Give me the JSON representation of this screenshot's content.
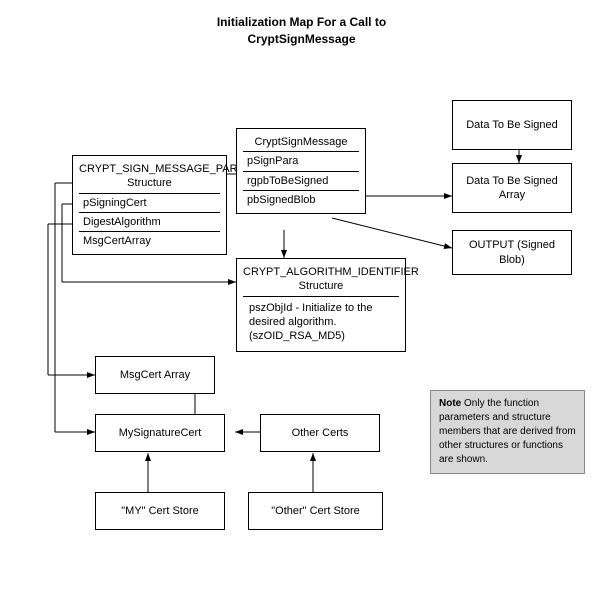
{
  "title": {
    "line1": "Initialization Map For a Call to",
    "line2": "CryptSignMessage"
  },
  "boxes": {
    "crypt_sign_message_para": {
      "header": "CRYPT_SIGN_MESSAGE_PARA Structure",
      "rows": [
        "pSigningCert",
        "DigestAlgorithm",
        "MsgCertArray"
      ]
    },
    "crypt_sign_message": {
      "header": "CryptSignMessage",
      "rows": [
        "pSignPara",
        "rgpbToBeSigned",
        "pbSignedBlob"
      ]
    },
    "crypt_algorithm": {
      "header": "CRYPT_ALGORITHM_IDENTIFIER Structure",
      "body": "pszObjId - Initialize to the desired algorithm. (szOID_RSA_MD5)"
    },
    "data_to_be_signed": {
      "label": "Data To Be Signed"
    },
    "data_to_be_signed_array": {
      "label": "Data To Be Signed Array"
    },
    "output": {
      "label": "OUTPUT (Signed Blob)"
    },
    "msgcert_array": {
      "label": "MsgCert Array"
    },
    "my_signature_cert": {
      "label": "MySignatureCert"
    },
    "other_certs": {
      "label": "Other Certs"
    },
    "my_cert_store": {
      "label": "\"MY\" Cert Store"
    },
    "other_cert_store": {
      "label": "\"Other\" Cert Store"
    }
  },
  "note": {
    "bold": "Note",
    "text": "  Only the function parameters and structure members that are derived from other structures or functions are shown."
  }
}
